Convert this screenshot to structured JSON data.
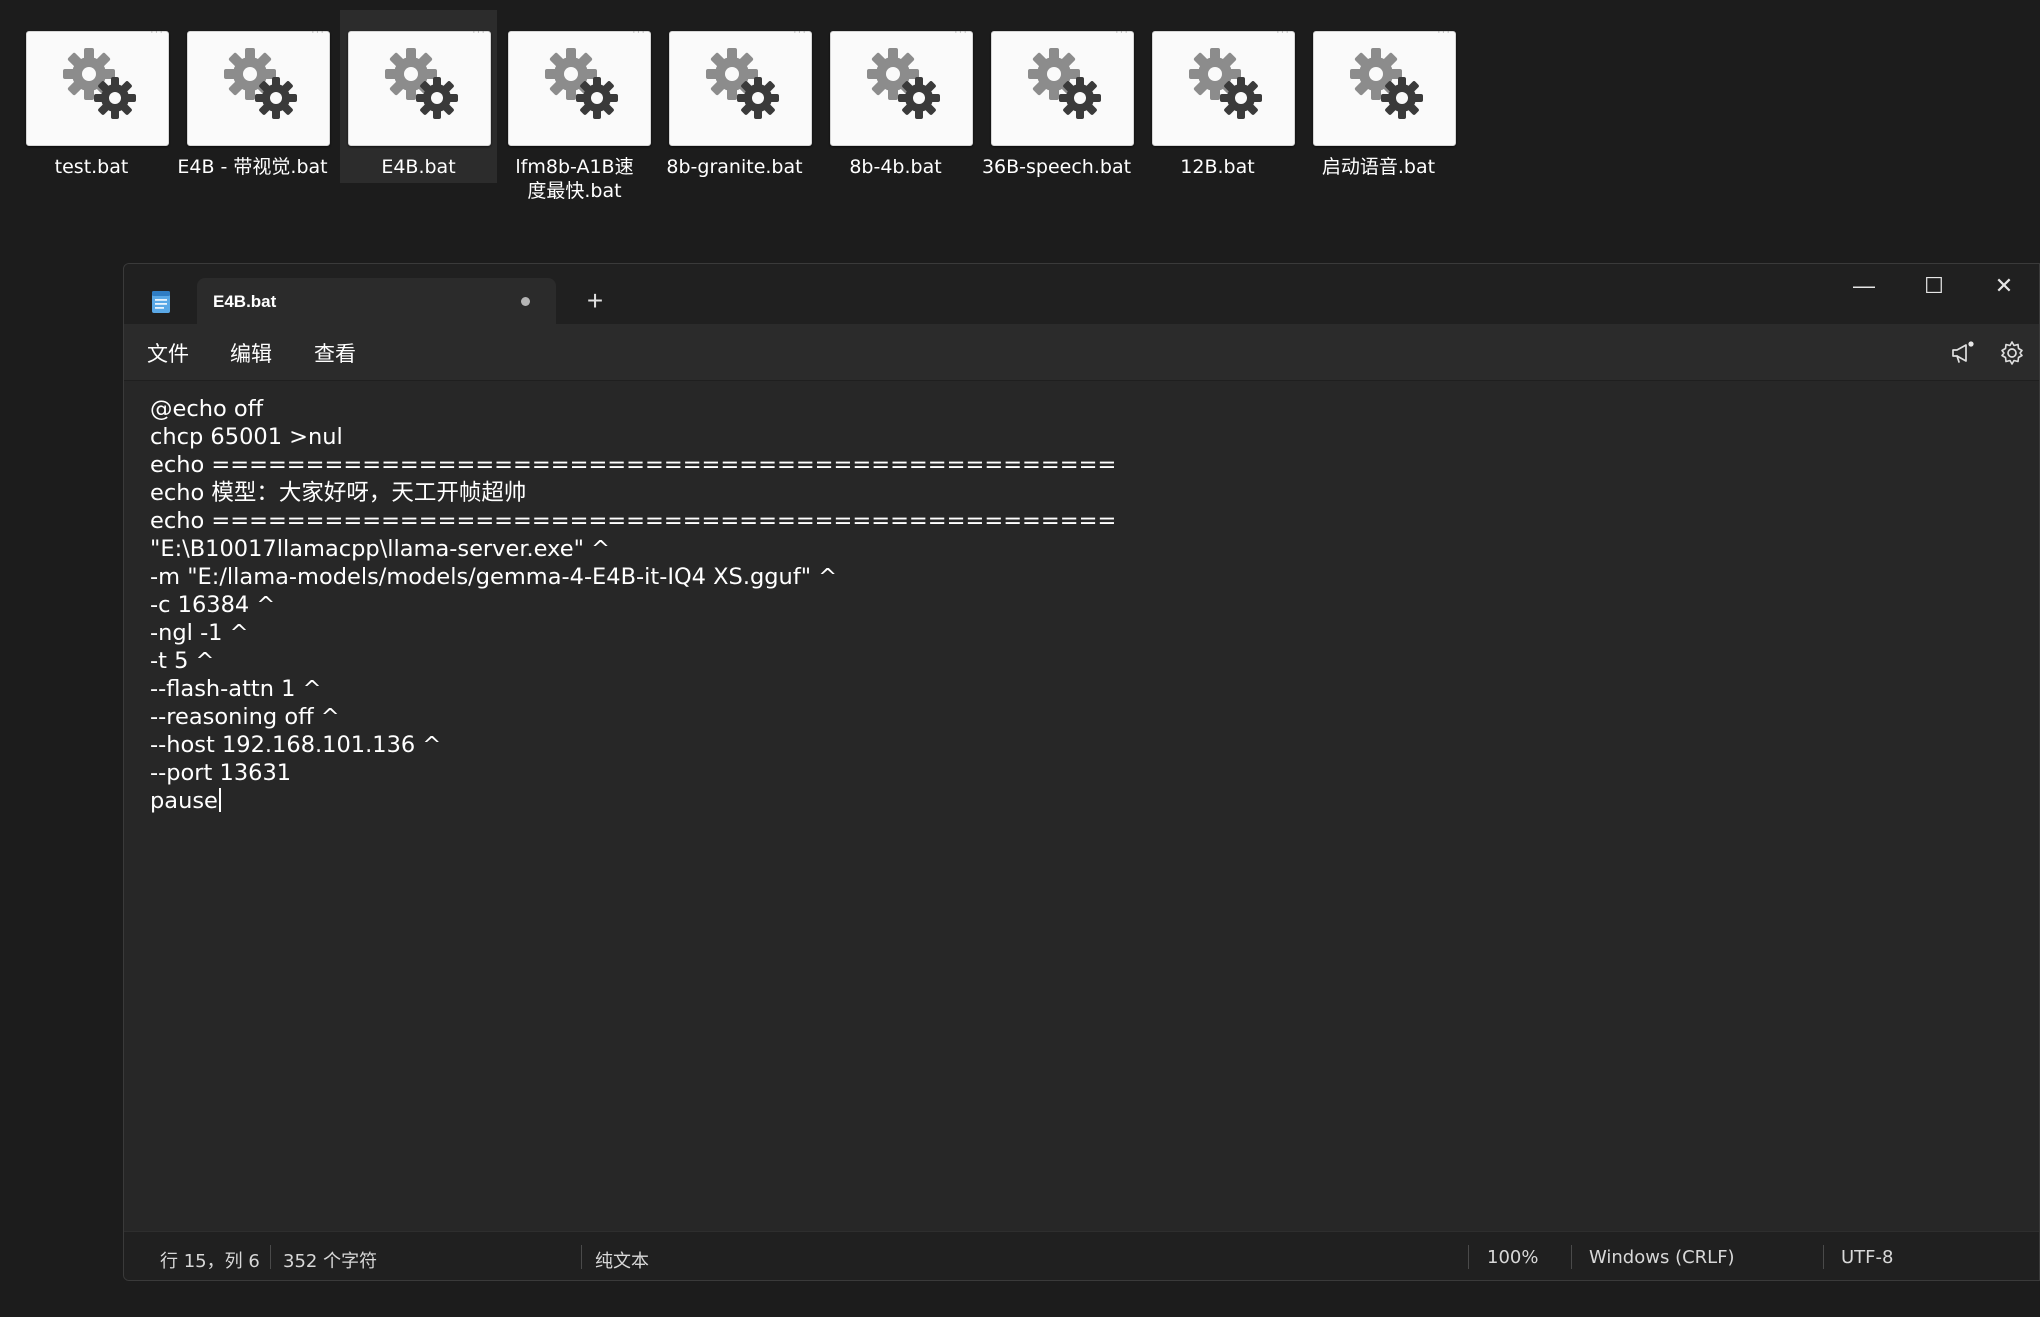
{
  "files": [
    {
      "label": "test.bat",
      "selected": false
    },
    {
      "label": "E4B - 带视觉.bat",
      "selected": false
    },
    {
      "label": "E4B.bat",
      "selected": true
    },
    {
      "label": "lfm8b-A1B速度最快.bat",
      "selected": false
    },
    {
      "label": "8b-granite.bat",
      "selected": false
    },
    {
      "label": "8b-4b.bat",
      "selected": false
    },
    {
      "label": "36B-speech.bat",
      "selected": false
    },
    {
      "label": "12B.bat",
      "selected": false
    },
    {
      "label": "启动语音.bat",
      "selected": false
    }
  ],
  "window": {
    "tab_title": "E4B.bat",
    "new_tab": "+",
    "controls": {
      "minimize": "—",
      "maximize": "☐",
      "close": "✕"
    }
  },
  "menu": {
    "file": "文件",
    "edit": "编辑",
    "view": "查看"
  },
  "editor": {
    "lines": [
      "@echo off",
      "chcp 65001 >nul",
      "echo ================================================",
      "echo 模型：大家好呀，天工开帧超帅",
      "echo ================================================",
      "\"E:\\B10017llamacpp\\llama-server.exe\" ^",
      "-m \"E:/llama-models/models/gemma-4-E4B-it-IQ4 XS.gguf\" ^",
      "-c 16384 ^",
      "-ngl -1 ^",
      "-t 5 ^",
      "--flash-attn 1 ^",
      "--reasoning off ^",
      "--host 192.168.101.136 ^",
      "--port 13631",
      "pause"
    ]
  },
  "status": {
    "position": "行 15，列 6",
    "char_count": "352 个字符",
    "format": "纯文本",
    "zoom": "100%",
    "line_ending": "Windows (CRLF)",
    "encoding": "UTF-8"
  }
}
